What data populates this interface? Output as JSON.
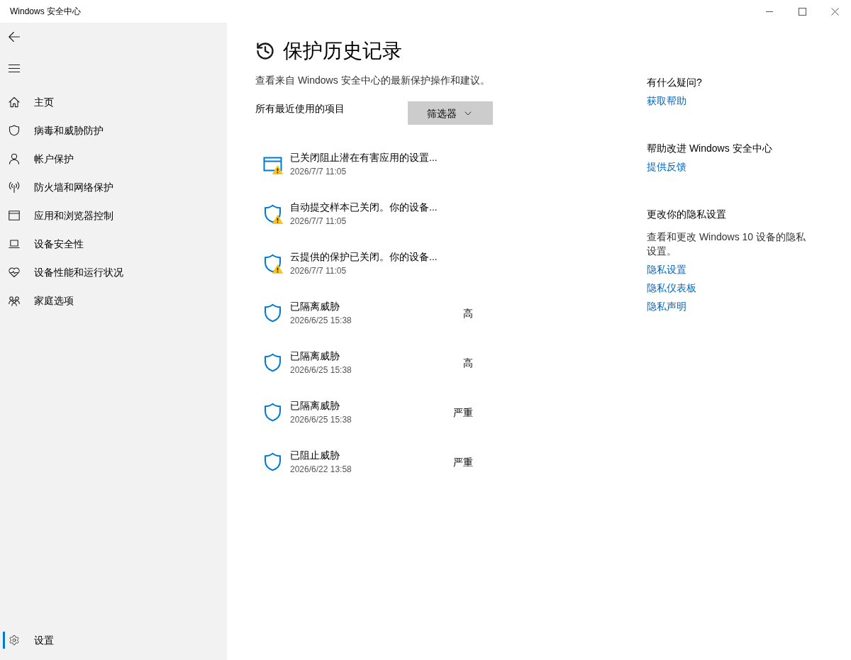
{
  "window": {
    "title": "Windows 安全中心"
  },
  "sidebar": {
    "items": [
      {
        "label": "主页",
        "selected": false
      },
      {
        "label": "病毒和威胁防护",
        "selected": false
      },
      {
        "label": "帐户保护",
        "selected": false
      },
      {
        "label": "防火墙和网络保护",
        "selected": false
      },
      {
        "label": "应用和浏览器控制",
        "selected": false
      },
      {
        "label": "设备安全性",
        "selected": false
      },
      {
        "label": "设备性能和运行状况",
        "selected": false
      },
      {
        "label": "家庭选项",
        "selected": false
      }
    ],
    "bottom_items": [
      {
        "label": "设置",
        "selected": true
      }
    ]
  },
  "main": {
    "title": "保护历史记录",
    "description": "查看来自 Windows 安全中心的最新保护操作和建议。",
    "list_label": "所有最近使用的项目",
    "filter_button": "筛选器",
    "items": [
      {
        "kind": "app",
        "warning": true,
        "title": "已关闭阻止潜在有害应用的设置...",
        "date": "2026/7/7 11:05"
      },
      {
        "kind": "shield",
        "warning": true,
        "title": "自动提交样本已关闭。你的设备...",
        "date": "2026/7/7 11:05"
      },
      {
        "kind": "shield",
        "warning": true,
        "title": "云提供的保护已关闭。你的设备...",
        "date": "2026/7/7 11:05"
      },
      {
        "kind": "shield",
        "warning": false,
        "title": "已隔离威胁",
        "date": "2026/6/25 15:38",
        "severity": "高"
      },
      {
        "kind": "shield",
        "warning": false,
        "title": "已隔离威胁",
        "date": "2026/6/25 15:38",
        "severity": "高"
      },
      {
        "kind": "shield",
        "warning": false,
        "title": "已隔离威胁",
        "date": "2026/6/25 15:38",
        "severity": "严重"
      },
      {
        "kind": "shield",
        "warning": false,
        "title": "已阻止威胁",
        "date": "2026/6/22 13:58",
        "severity": "严重"
      }
    ]
  },
  "help_panel": {
    "sections": [
      {
        "heading": "有什么疑问?",
        "links": [
          "获取帮助"
        ]
      },
      {
        "heading": "帮助改进 Windows 安全中心",
        "links": [
          "提供反馈"
        ]
      },
      {
        "heading": "更改你的隐私设置",
        "text": "查看和更改 Windows 10 设备的隐私设置。",
        "links": [
          "隐私设置",
          "隐私仪表板",
          "隐私声明"
        ]
      }
    ]
  }
}
